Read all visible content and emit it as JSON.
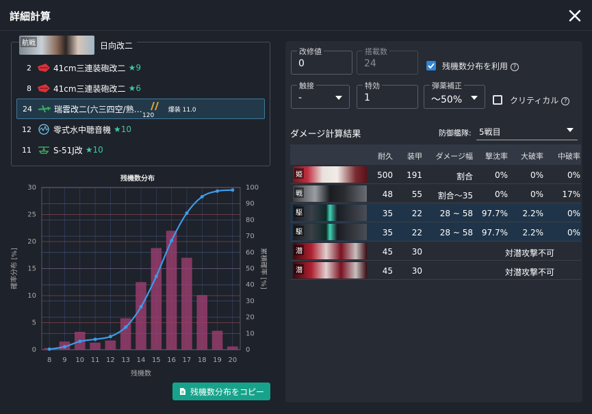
{
  "window": {
    "title": "詳細計算"
  },
  "ship": {
    "banner_tag": "航戦",
    "name": "日向改二"
  },
  "equipment": [
    {
      "slot": "2",
      "name": "41cm三連装砲改二",
      "improve": "★9",
      "icon": "main-gun-icon",
      "color": "#d8333a"
    },
    {
      "slot": "8",
      "name": "41cm三連装砲改二",
      "improve": "★6",
      "icon": "main-gun-icon",
      "color": "#d8333a"
    },
    {
      "slot": "24",
      "name": "瑞雲改二(六三四空/熟…",
      "improve": "",
      "icon": "seaplane-bomber-icon",
      "color": "#3aa860",
      "proficiency": "120",
      "stat": "爆装 11.0"
    },
    {
      "slot": "12",
      "name": "零式水中聴音機",
      "improve": "★10",
      "icon": "sonar-icon",
      "color": "#6ab8e0"
    },
    {
      "slot": "11",
      "name": "S-51J改",
      "improve": "★10",
      "icon": "helicopter-icon",
      "color": "#3aa860"
    }
  ],
  "chart_data": {
    "type": "bar+line",
    "title": "残機数分布",
    "xlabel": "残機数",
    "ylabel_left": "確率分布 [%]",
    "ylabel_right": "累積確率 [%]",
    "categories": [
      "8",
      "9",
      "10",
      "11",
      "12",
      "13",
      "14",
      "15",
      "16",
      "17",
      "18",
      "19",
      "20"
    ],
    "x_ticks": [
      "8",
      "9",
      "10",
      "11",
      "12",
      "13",
      "14",
      "15",
      "16",
      "17",
      "18",
      "19",
      "20"
    ],
    "ylim_left": [
      0,
      30
    ],
    "ylim_right": [
      0,
      100
    ],
    "y_ticks_left": [
      "0",
      "5",
      "10",
      "15",
      "20",
      "25",
      "30"
    ],
    "y_ticks_right": [
      "0",
      "10",
      "20",
      "30",
      "40",
      "50",
      "60",
      "70",
      "80",
      "90",
      "100"
    ],
    "series": [
      {
        "type": "bar",
        "axis": "left",
        "values": [
          0.3,
          1.5,
          3.3,
          1.3,
          1.7,
          5.8,
          12.5,
          18.8,
          22.0,
          17.0,
          10.1,
          3.5,
          0.6
        ]
      },
      {
        "type": "line",
        "axis": "right",
        "values": [
          0.3,
          1.8,
          5.1,
          6.4,
          8.1,
          13.9,
          26.4,
          45.2,
          67.2,
          84.2,
          94.3,
          97.8,
          98.4
        ]
      }
    ],
    "bar_color": "#9c3f6f",
    "line_color": "#3d9be9",
    "grid": true
  },
  "copy_button": {
    "label": "残機数分布をコピー",
    "icon": "document-icon"
  },
  "controls": {
    "improvement": {
      "label": "改修値",
      "value": "0"
    },
    "slot_count": {
      "label": "搭載数",
      "value": "24"
    },
    "use_distribution": {
      "label": "残機数分布を利用",
      "checked": true
    },
    "contact": {
      "label": "触接",
      "value": "-"
    },
    "special_attack": {
      "label": "特効",
      "value": "1"
    },
    "ammo_correction": {
      "label": "弾薬補正",
      "value": "〜50%"
    },
    "critical": {
      "label": "クリティカル",
      "checked": false
    }
  },
  "results": {
    "title": "ダメージ計算結果",
    "defense_label": "防御艦隊:",
    "defense_value": "5戦目",
    "headers": [
      "耐久",
      "装甲",
      "ダメージ幅",
      "撃沈率",
      "大破率",
      "中破率"
    ],
    "rows": [
      {
        "tag": "姫",
        "hp": "500",
        "armor": "191",
        "range": "割合",
        "sink": "0%",
        "heavy": "0%",
        "moderate": "0%",
        "note": "",
        "highlight": false
      },
      {
        "tag": "戦",
        "hp": "48",
        "armor": "55",
        "range": "割合～35",
        "sink": "0%",
        "heavy": "0%",
        "moderate": "17%",
        "note": "",
        "highlight": false
      },
      {
        "tag": "駆",
        "hp": "35",
        "armor": "22",
        "range": "28 ~ 58",
        "sink": "97.7%",
        "heavy": "2.2%",
        "moderate": "0%",
        "note": "",
        "highlight": true
      },
      {
        "tag": "駆",
        "hp": "35",
        "armor": "22",
        "range": "28 ~ 58",
        "sink": "97.7%",
        "heavy": "2.2%",
        "moderate": "0%",
        "note": "",
        "highlight": true
      },
      {
        "tag": "潜",
        "hp": "45",
        "armor": "30",
        "range": "",
        "sink": "",
        "heavy": "",
        "moderate": "",
        "note": "対潜攻撃不可",
        "highlight": false
      },
      {
        "tag": "潜",
        "hp": "45",
        "armor": "30",
        "range": "",
        "sink": "",
        "heavy": "",
        "moderate": "",
        "note": "対潜攻撃不可",
        "highlight": false
      }
    ]
  }
}
